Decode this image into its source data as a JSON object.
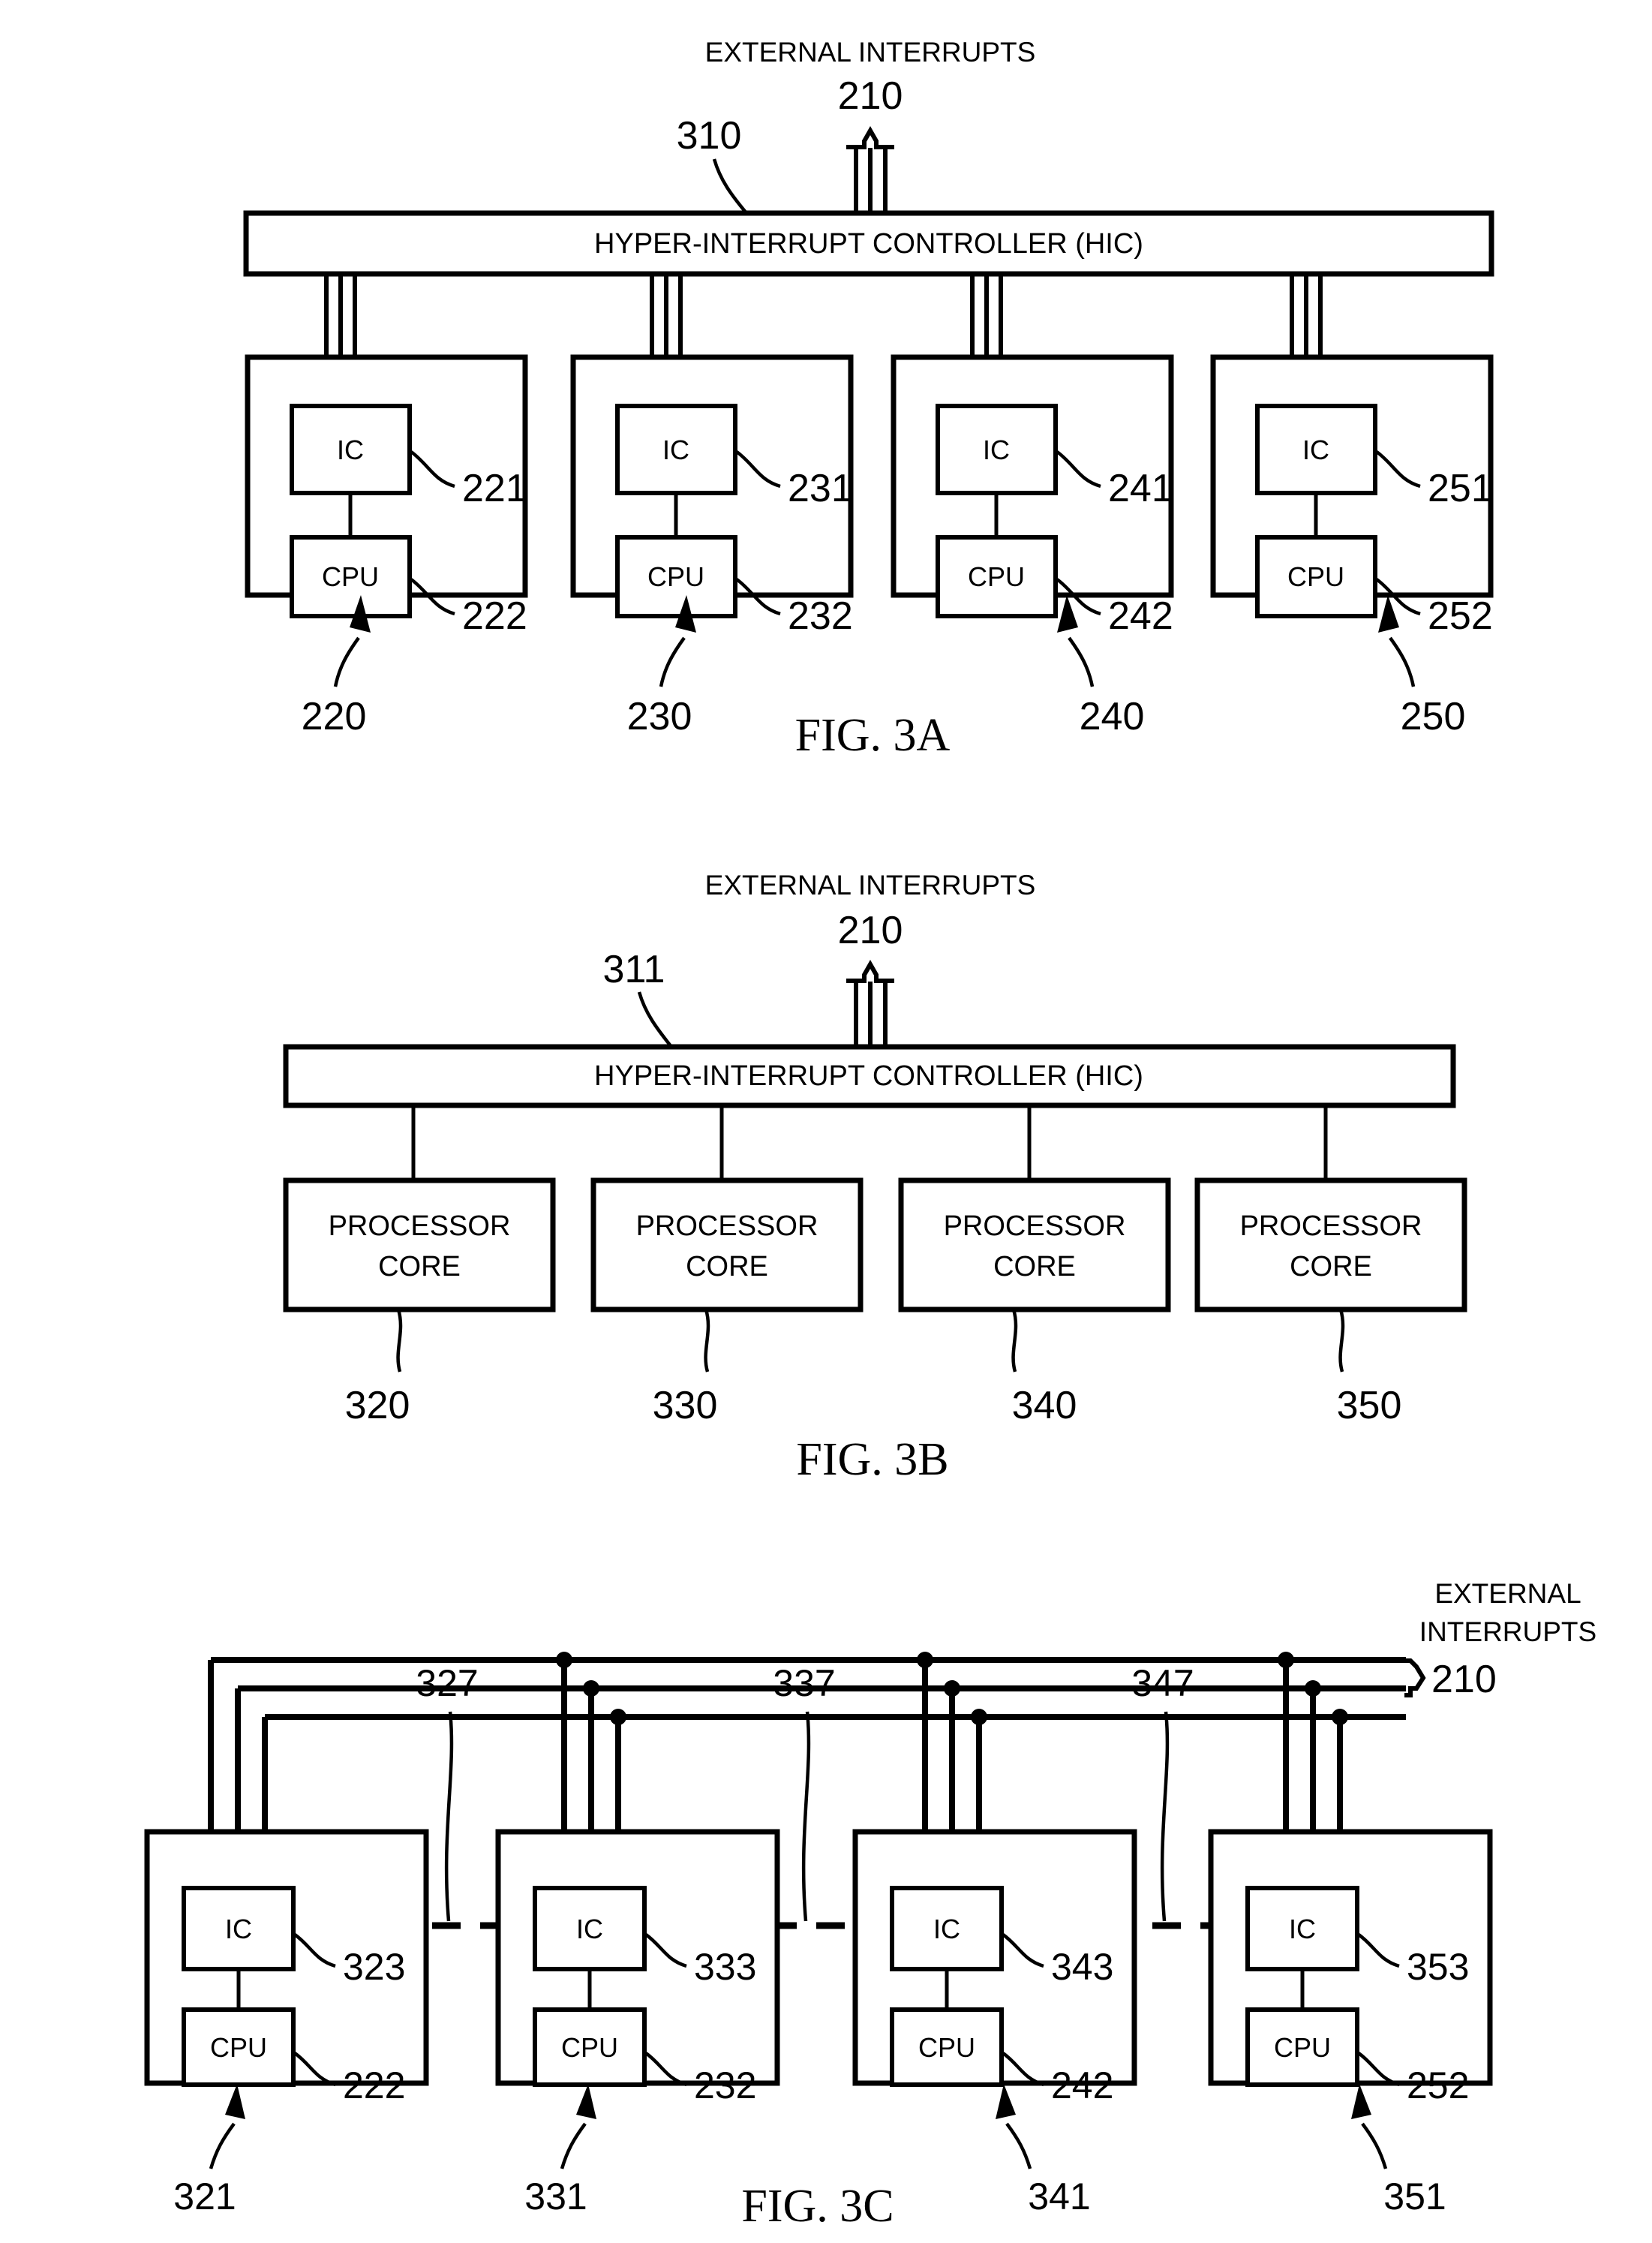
{
  "document": {
    "type": "patent-figure-sheet",
    "figures": [
      "FIG. 3A",
      "FIG. 3B",
      "FIG. 3C"
    ]
  },
  "fig3a": {
    "caption": "FIG. 3A",
    "external_interrupts_label": "EXTERNAL INTERRUPTS",
    "external_interrupts_ref": "210",
    "hic_label": "HYPER-INTERRUPT CONTROLLER (HIC)",
    "hic_ref": "310",
    "cores": [
      {
        "core_ref": "220",
        "ic_label": "IC",
        "ic_ref": "221",
        "cpu_label": "CPU",
        "cpu_ref": "222"
      },
      {
        "core_ref": "230",
        "ic_label": "IC",
        "ic_ref": "231",
        "cpu_label": "CPU",
        "cpu_ref": "232"
      },
      {
        "core_ref": "240",
        "ic_label": "IC",
        "ic_ref": "241",
        "cpu_label": "CPU",
        "cpu_ref": "242"
      },
      {
        "core_ref": "250",
        "ic_label": "IC",
        "ic_ref": "251",
        "cpu_label": "CPU",
        "cpu_ref": "252"
      }
    ]
  },
  "fig3b": {
    "caption": "FIG. 3B",
    "external_interrupts_label": "EXTERNAL INTERRUPTS",
    "external_interrupts_ref": "210",
    "hic_label": "HYPER-INTERRUPT CONTROLLER (HIC)",
    "hic_ref": "311",
    "cores": [
      {
        "line1": "PROCESSOR",
        "line2": "CORE",
        "core_ref": "320"
      },
      {
        "line1": "PROCESSOR",
        "line2": "CORE",
        "core_ref": "330"
      },
      {
        "line1": "PROCESSOR",
        "line2": "CORE",
        "core_ref": "340"
      },
      {
        "line1": "PROCESSOR",
        "line2": "CORE",
        "core_ref": "350"
      }
    ]
  },
  "fig3c": {
    "caption": "FIG. 3C",
    "external_interrupts_line1": "EXTERNAL",
    "external_interrupts_line2": "INTERRUPTS",
    "external_interrupts_ref": "210",
    "link_refs": [
      "327",
      "337",
      "347"
    ],
    "cores": [
      {
        "core_ref": "321",
        "ic_label": "IC",
        "ic_ref": "323",
        "cpu_label": "CPU",
        "cpu_ref": "222"
      },
      {
        "core_ref": "331",
        "ic_label": "IC",
        "ic_ref": "333",
        "cpu_label": "CPU",
        "cpu_ref": "232"
      },
      {
        "core_ref": "341",
        "ic_label": "IC",
        "ic_ref": "343",
        "cpu_label": "CPU",
        "cpu_ref": "242"
      },
      {
        "core_ref": "351",
        "ic_label": "IC",
        "ic_ref": "353",
        "cpu_label": "CPU",
        "cpu_ref": "252"
      }
    ]
  }
}
